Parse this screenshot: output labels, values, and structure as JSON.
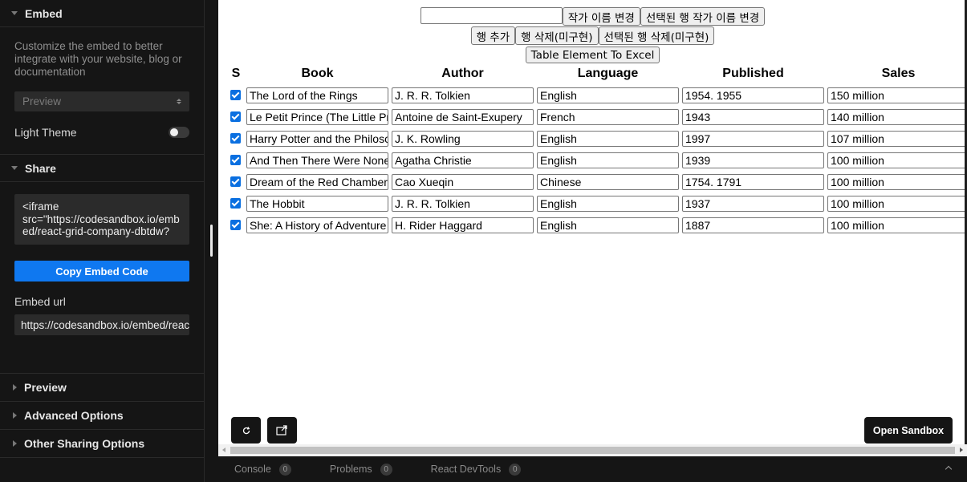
{
  "sidebar": {
    "embed_title": "Embed",
    "embed_desc": "Customize the embed to better integrate with your website, blog or documentation",
    "preview_select": "Preview",
    "light_theme_label": "Light Theme",
    "light_theme_on": false,
    "share_title": "Share",
    "iframe_code": "<iframe\nsrc=\"https://codesandbox.io/embed/react-grid-company-dbtdw?",
    "copy_button": "Copy Embed Code",
    "embed_url_label": "Embed url",
    "embed_url": "https://codesandbox.io/embed/react-grid-company-dbtdw",
    "collapsed": [
      "Preview",
      "Advanced Options",
      "Other Sharing Options"
    ]
  },
  "preview": {
    "author_input": "",
    "btn_rename_author": "작가 이름 변경",
    "btn_rename_selected": "선택된 행 작가 이름 변경",
    "btn_add_row": "행 추가",
    "btn_delete_row": "행 삭제(미구현)",
    "btn_delete_selected": "선택된 행 삭제(미구현)",
    "btn_export": "Table Element To Excel",
    "headers": [
      "S",
      "Book",
      "Author",
      "Language",
      "Published",
      "Sales"
    ],
    "rows": [
      {
        "checked": true,
        "book": "The Lord of the Rings",
        "author": "J. R. R. Tolkien",
        "language": "English",
        "published": "1954. 1955",
        "sales": "150 million"
      },
      {
        "checked": true,
        "book": "Le Petit Prince (The Little Prince)",
        "author": "Antoine de Saint-Exupery",
        "language": "French",
        "published": "1943",
        "sales": "140 million"
      },
      {
        "checked": true,
        "book": "Harry Potter and the Philosopher's Stone",
        "author": "J. K. Rowling",
        "language": "English",
        "published": "1997",
        "sales": "107 million"
      },
      {
        "checked": true,
        "book": "And Then There Were None",
        "author": "Agatha Christie",
        "language": "English",
        "published": "1939",
        "sales": "100 million"
      },
      {
        "checked": true,
        "book": "Dream of the Red Chamber",
        "author": "Cao Xueqin",
        "language": "Chinese",
        "published": "1754. 1791",
        "sales": "100 million"
      },
      {
        "checked": true,
        "book": "The Hobbit",
        "author": "J. R. R. Tolkien",
        "language": "English",
        "published": "1937",
        "sales": "100 million"
      },
      {
        "checked": true,
        "book": "She: A History of Adventure",
        "author": "H. Rider Haggard",
        "language": "English",
        "published": "1887",
        "sales": "100 million"
      }
    ],
    "open_sandbox": "Open Sandbox"
  },
  "bottombar": {
    "tabs": [
      {
        "label": "Console",
        "count": "0"
      },
      {
        "label": "Problems",
        "count": "0"
      },
      {
        "label": "React DevTools",
        "count": "0"
      }
    ]
  },
  "colors": {
    "accent": "#0f78f0",
    "checkbox": "#0a6fe0",
    "dark_bg": "#151515"
  }
}
